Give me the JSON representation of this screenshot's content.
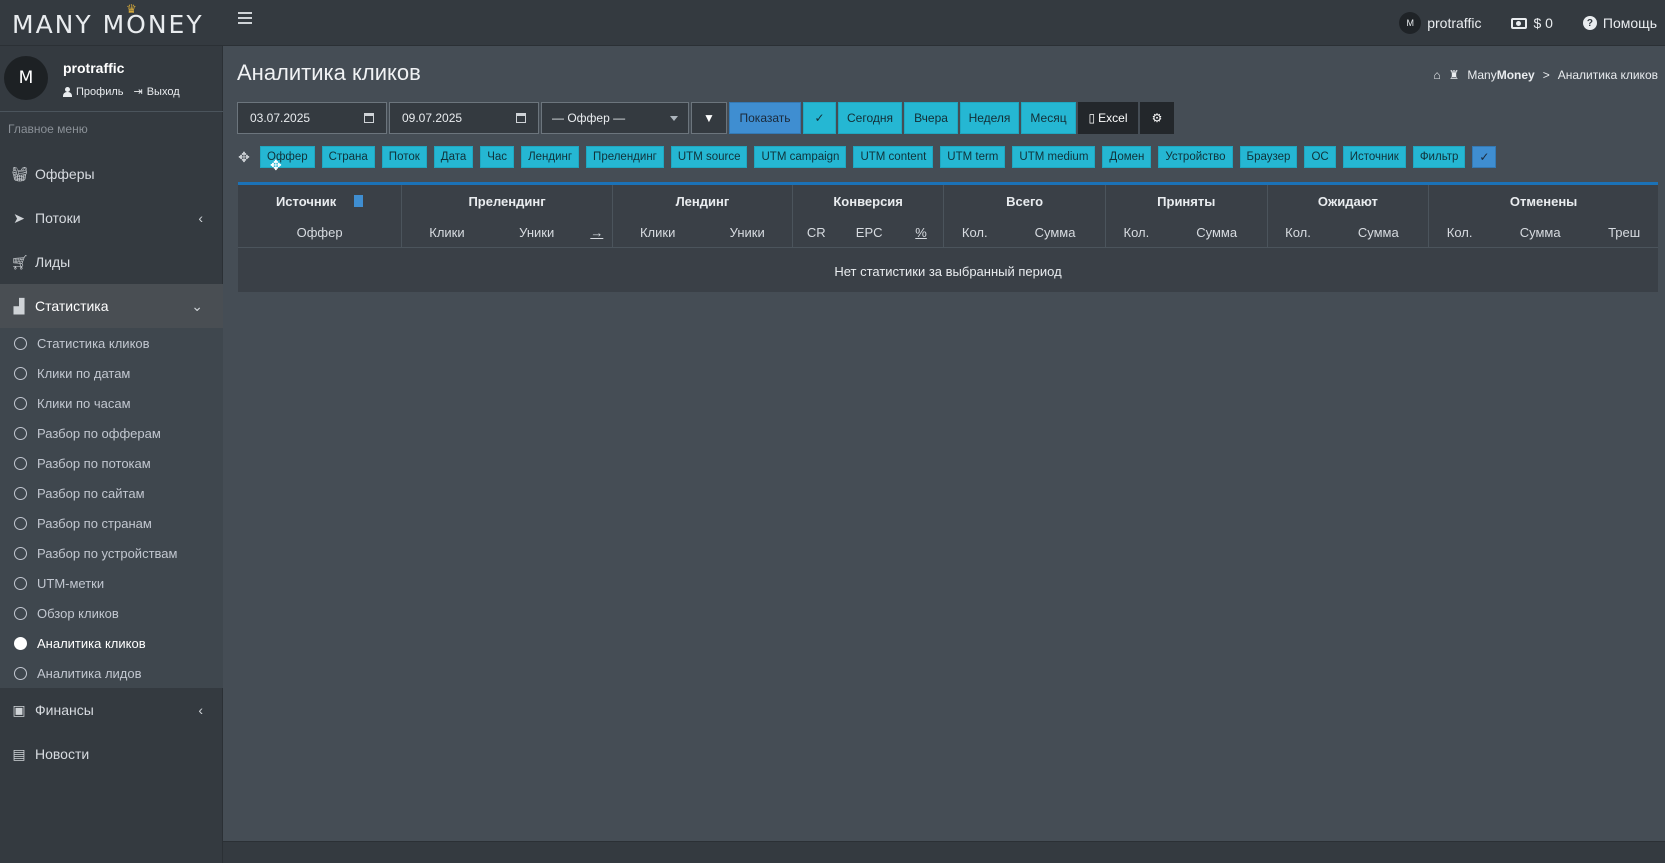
{
  "app": {
    "logo_text": "MANY MONEY",
    "logo_crown": "♛"
  },
  "topbar": {
    "username": "protraffic",
    "avatar_initials": "M",
    "balance": "$ 0",
    "help_label": "Помощь"
  },
  "user_panel": {
    "name": "protraffic",
    "avatar_initials": "M",
    "profile_label": "Профиль",
    "logout_label": "Выход"
  },
  "sidebar": {
    "header": "Главное меню",
    "items": [
      {
        "label": "Офферы",
        "icon": "basket-icon"
      },
      {
        "label": "Потоки",
        "icon": "paper-plane-icon"
      },
      {
        "label": "Лиды",
        "icon": "cart-icon"
      },
      {
        "label": "Статистика",
        "icon": "chart-area-icon"
      },
      {
        "label": "Финансы",
        "icon": "money-bill-icon"
      },
      {
        "label": "Новости",
        "icon": "newspaper-icon"
      }
    ],
    "stats_submenu": [
      "Статистика кликов",
      "Клики по датам",
      "Клики по часам",
      "Разбор по офферам",
      "Разбор по потокам",
      "Разбор по сайтам",
      "Разбор по странам",
      "Разбор по устройствам",
      "UTM-метки",
      "Обзор кликов",
      "Аналитика кликов",
      "Аналитика лидов"
    ],
    "active_submenu": "Аналитика кликов"
  },
  "page": {
    "title": "Аналитика кликов",
    "breadcrumb": {
      "brand_prefix": "Many",
      "brand_bold": "Money",
      "separator": ">",
      "current": "Аналитика кликов"
    }
  },
  "filters": {
    "date_from": "03.07.2025",
    "date_to": "09.07.2025",
    "offer_select": "— Оффер —",
    "show_label": "Показать",
    "today_label": "Сегодня",
    "yesterday_label": "Вчера",
    "week_label": "Неделя",
    "month_label": "Месяц",
    "excel_label": "Excel"
  },
  "group_tags": [
    "Оффер",
    "Страна",
    "Поток",
    "Дата",
    "Час",
    "Лендинг",
    "Прелендинг",
    "UTM source",
    "UTM campaign",
    "UTM content",
    "UTM term",
    "UTM medium",
    "Домен",
    "Устройство",
    "Браузер",
    "ОС",
    "Источник",
    "Фильтр"
  ],
  "table": {
    "group_headers": {
      "source": "Источник",
      "prelanding": "Прелендинг",
      "landing": "Лендинг",
      "conversion": "Конверсия",
      "total": "Всего",
      "accepted": "Приняты",
      "pending": "Ожидают",
      "cancelled": "Отменены"
    },
    "sub_headers": {
      "offer": "Оффер",
      "pre_clicks": "Клики",
      "pre_uniq": "Уники",
      "pre_arrow": "→",
      "land_clicks": "Клики",
      "land_uniq": "Уники",
      "cr": "CR",
      "epc": "EPC",
      "pct": "%",
      "total_count": "Кол.",
      "total_sum": "Сумма",
      "acc_count": "Кол.",
      "acc_sum": "Сумма",
      "pend_count": "Кол.",
      "pend_sum": "Сумма",
      "canc_count": "Кол.",
      "canc_sum": "Сумма",
      "trash": "Треш"
    },
    "empty_message": "Нет статистики за выбранный период"
  }
}
